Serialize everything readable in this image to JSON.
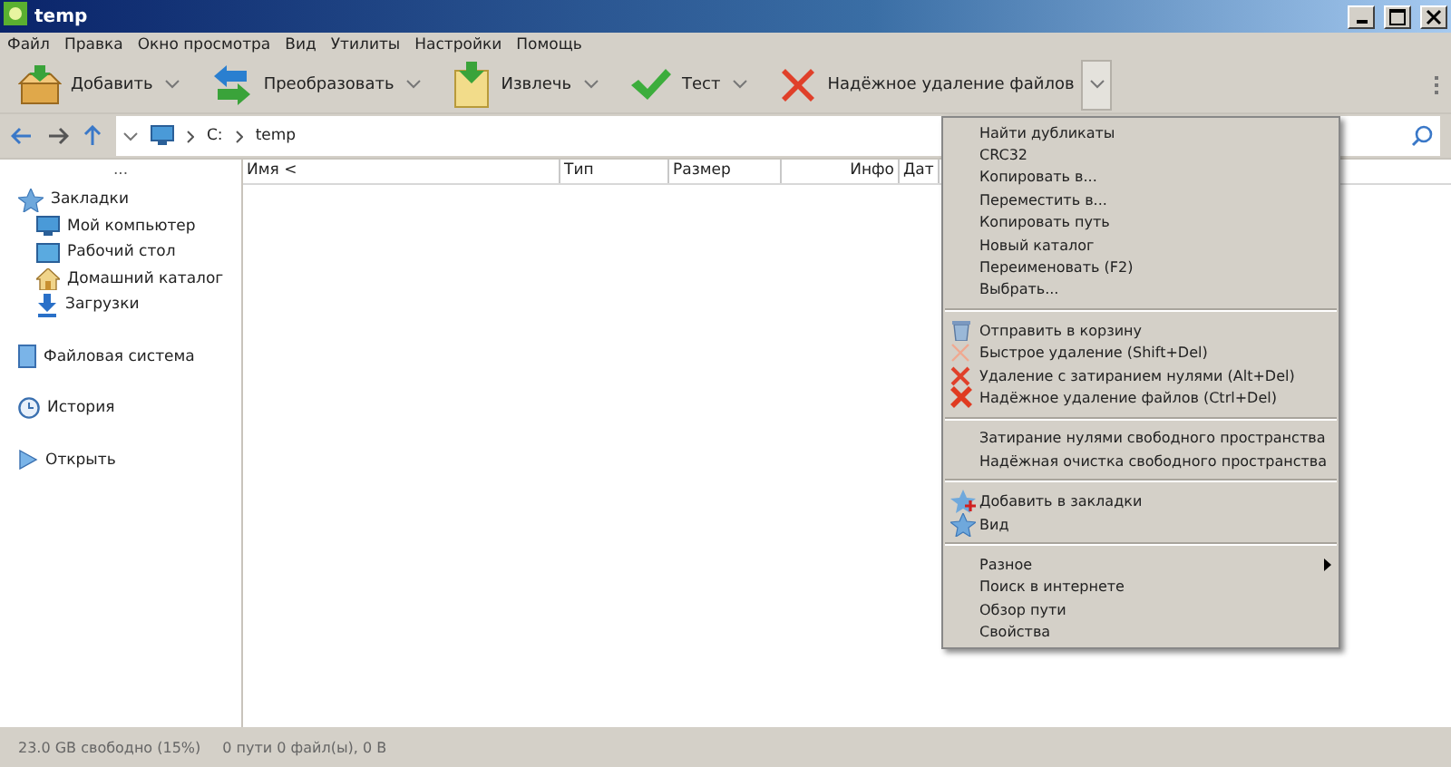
{
  "window": {
    "title": "temp"
  },
  "menu_bar": [
    "Файл",
    "Правка",
    "Окно просмотра",
    "Вид",
    "Утилиты",
    "Настройки",
    "Помощь"
  ],
  "toolbar": [
    {
      "label": "Добавить",
      "expanded": false
    },
    {
      "label": "Преобразовать",
      "expanded": false
    },
    {
      "label": "Извлечь",
      "expanded": false
    },
    {
      "label": "Тест",
      "expanded": false
    },
    {
      "label": "Надёжное удаление файлов",
      "expanded": true
    }
  ],
  "address_bar": {
    "path": [
      "C:",
      "temp"
    ]
  },
  "sidebar": {
    "more": "...",
    "sections": [
      {
        "label": "Закладки",
        "children": [
          {
            "label": "Мой компьютер"
          },
          {
            "label": "Рабочий стол"
          },
          {
            "label": "Домашний каталог"
          },
          {
            "label": "Загрузки"
          }
        ]
      },
      {
        "label": "Файловая система"
      },
      {
        "label": "История"
      },
      {
        "label": "Открыть"
      }
    ]
  },
  "table": {
    "columns": [
      "Имя <",
      "Тип",
      "Размер",
      "Инфо",
      "Дат"
    ]
  },
  "context_menu": [
    [
      {
        "label": "Найти дубликаты",
        "kind": "plain"
      },
      {
        "label": "CRC32",
        "kind": "plain"
      },
      {
        "label": "Копировать в...",
        "kind": "plain"
      },
      {
        "label": "Переместить в...",
        "kind": "plain"
      },
      {
        "label": "Копировать путь",
        "kind": "plain"
      },
      {
        "label": "Новый каталог",
        "kind": "plain"
      },
      {
        "label": "Переименовать (F2)",
        "kind": "plain"
      },
      {
        "label": "Выбрать...",
        "kind": "plain"
      }
    ],
    [
      {
        "label": "Отправить в корзину",
        "kind": "trash"
      },
      {
        "label": "Быстрое удаление (Shift+Del)",
        "kind": "quick-delete"
      },
      {
        "label": "Удаление с затиранием нулями (Alt+Del)",
        "kind": "delete"
      },
      {
        "label": "Надёжное удаление файлов (Ctrl+Del)",
        "kind": "secure-delete"
      }
    ],
    [
      {
        "label": "Затирание нулями свободного пространства",
        "kind": "plain"
      },
      {
        "label": "Надёжная очистка свободного пространства",
        "kind": "plain"
      }
    ],
    [
      {
        "label": "Добавить в закладки",
        "kind": "bookmark-add"
      },
      {
        "label": "Вид",
        "kind": "bookmark"
      }
    ],
    [
      {
        "label": "Разное",
        "kind": "submenu"
      },
      {
        "label": "Поиск в интернете",
        "kind": "plain"
      },
      {
        "label": "Обзор пути",
        "kind": "plain"
      },
      {
        "label": "Свойства",
        "kind": "plain"
      }
    ]
  ],
  "status_bar": [
    "23.0 GB свободно (15%)",
    "0 пути 0 файл(ы), 0 B"
  ]
}
